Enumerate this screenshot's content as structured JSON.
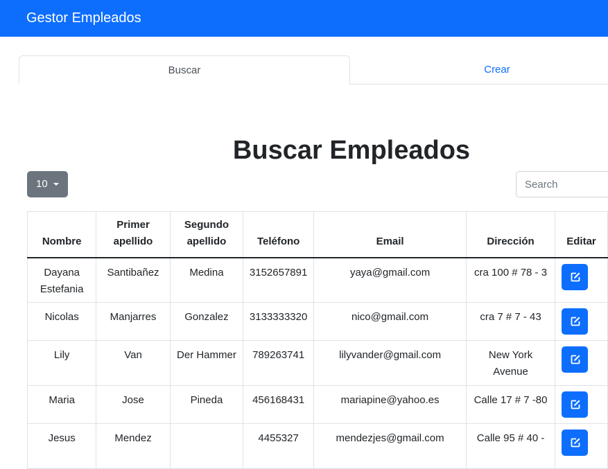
{
  "navbar": {
    "brand": "Gestor Empleados"
  },
  "tabs": [
    {
      "label": "Buscar",
      "active": true
    },
    {
      "label": "Crear",
      "active": false
    }
  ],
  "page_title": "Buscar Empleados",
  "controls": {
    "page_size": "10",
    "search_placeholder": "Search"
  },
  "table": {
    "headers": [
      "Nombre",
      "Primer apellido",
      "Segundo apellido",
      "Teléfono",
      "Email",
      "Dirección",
      "Editar"
    ],
    "rows": [
      [
        "Dayana Estefania",
        "Santibañez",
        "Medina",
        "3152657891",
        "yaya@gmail.com",
        "cra 100 # 78 - 3"
      ],
      [
        "Nicolas",
        "Manjarres",
        "Gonzalez",
        "3133333320",
        "nico@gmail.com",
        "cra 7 # 7 - 43"
      ],
      [
        "Lily",
        "Van",
        "Der Hammer",
        "789263741",
        "lilyvander@gmail.com",
        "New York Avenue"
      ],
      [
        "Maria",
        "Jose",
        "Pineda",
        "456168431",
        "mariapine@yahoo.es",
        "Calle 17 # 7 -80"
      ],
      [
        "Jesus",
        "Mendez",
        "",
        "4455327",
        "mendezjes@gmail.com",
        "Calle 95 # 40 -"
      ]
    ]
  },
  "colors": {
    "primary": "#0d6efd",
    "secondary": "#6c757d",
    "text": "#212529"
  },
  "icons": {
    "edit": "pencil-square-icon",
    "caret": "caret-down-icon"
  }
}
